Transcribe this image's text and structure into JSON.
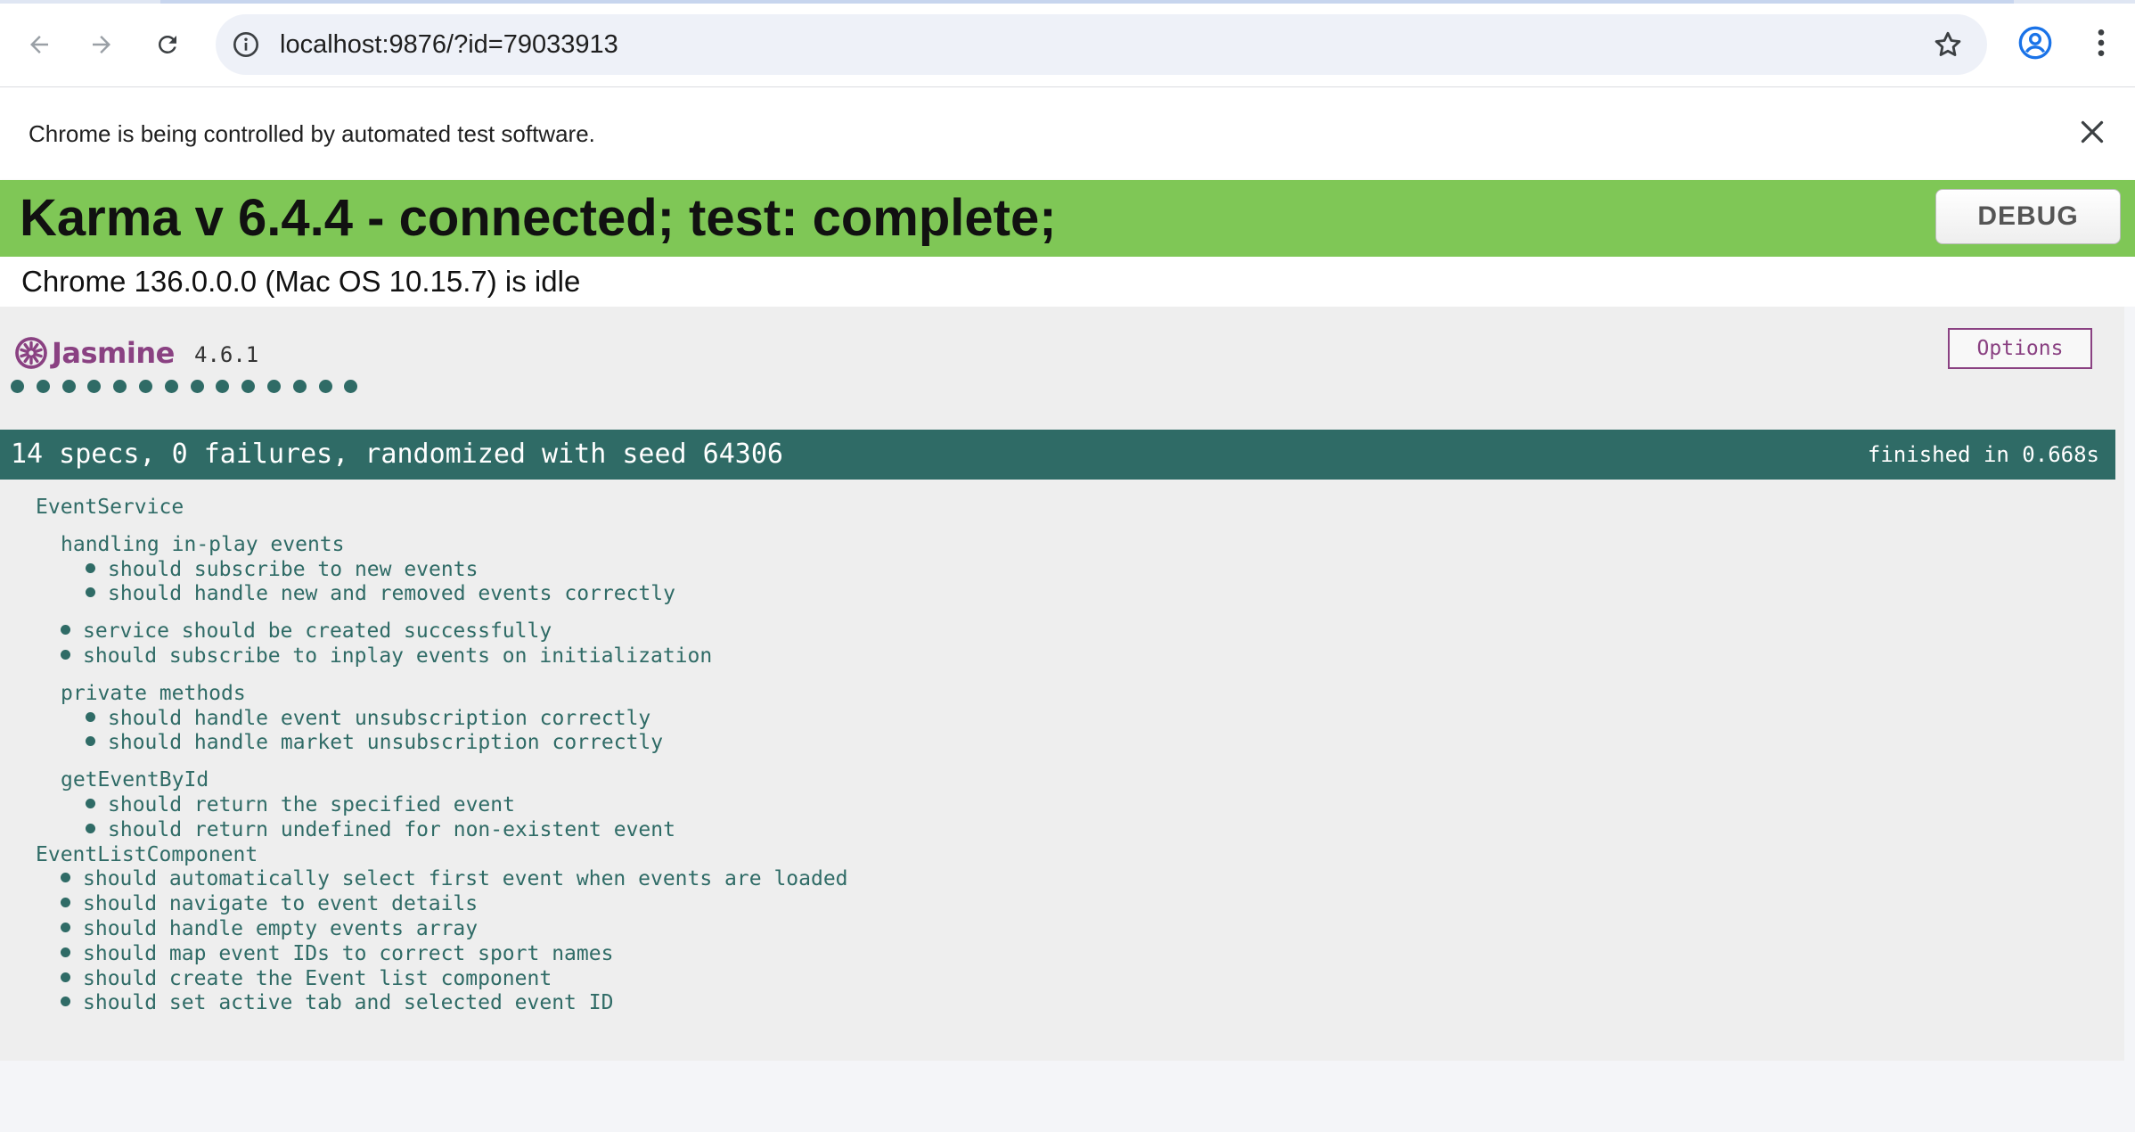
{
  "browser": {
    "url": "localhost:9876/?id=79033913",
    "infobar_message": "Chrome is being controlled by automated test software."
  },
  "karma": {
    "title": "Karma v 6.4.4 - connected; test: complete;",
    "debug_label": "DEBUG",
    "browser_status": "Chrome 136.0.0.0 (Mac OS 10.15.7) is idle"
  },
  "jasmine": {
    "logo_text": "Jasmine",
    "version": "4.6.1",
    "options_label": "Options",
    "passed_count": 14,
    "summary": "14 specs, 0 failures, randomized with seed 64306",
    "duration": "finished in 0.668s",
    "results": [
      {
        "type": "suite",
        "level": 0,
        "label": "EventService"
      },
      {
        "type": "suite",
        "level": 1,
        "label": "handling in-play events"
      },
      {
        "type": "spec",
        "level": 2,
        "label": "should subscribe to new events"
      },
      {
        "type": "spec",
        "level": 2,
        "label": "should handle new and removed events correctly"
      },
      {
        "type": "spec",
        "level": 1,
        "label": "service should be created successfully"
      },
      {
        "type": "spec",
        "level": 1,
        "label": "should subscribe to inplay events on initialization"
      },
      {
        "type": "suite",
        "level": 1,
        "label": "private methods"
      },
      {
        "type": "spec",
        "level": 2,
        "label": "should handle event unsubscription correctly"
      },
      {
        "type": "spec",
        "level": 2,
        "label": "should handle market unsubscription correctly"
      },
      {
        "type": "suite",
        "level": 1,
        "label": "getEventById"
      },
      {
        "type": "spec",
        "level": 2,
        "label": "should return the specified event"
      },
      {
        "type": "spec",
        "level": 2,
        "label": "should return undefined for non-existent event"
      },
      {
        "type": "suite",
        "level": 0,
        "label": "EventListComponent"
      },
      {
        "type": "spec",
        "level": 1,
        "label": "should automatically select first event when events are loaded"
      },
      {
        "type": "spec",
        "level": 1,
        "label": "should navigate to event details"
      },
      {
        "type": "spec",
        "level": 1,
        "label": "should handle empty events array"
      },
      {
        "type": "spec",
        "level": 1,
        "label": "should map event IDs to correct sport names"
      },
      {
        "type": "spec",
        "level": 1,
        "label": "should create the Event list component"
      },
      {
        "type": "spec",
        "level": 1,
        "label": "should set active tab and selected event ID"
      }
    ]
  },
  "colors": {
    "karma_green": "#7fc756",
    "jasmine_teal": "#2f6b66",
    "jasmine_purple": "#8a4182"
  }
}
